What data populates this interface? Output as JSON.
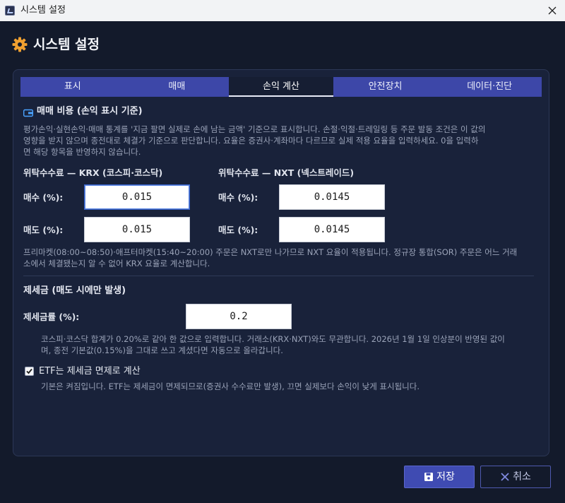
{
  "window": {
    "title": "시스템 설정"
  },
  "header": {
    "title": "시스템 설정"
  },
  "tabs": [
    {
      "label": "표시",
      "active": false
    },
    {
      "label": "매매",
      "active": false
    },
    {
      "label": "손익 계산",
      "active": true
    },
    {
      "label": "안전장치",
      "active": false
    },
    {
      "label": "데이터·진단",
      "active": false
    }
  ],
  "cost_section": {
    "title": "매매 비용 (손익 표시 기준)",
    "description_line1": "평가손익·실현손익·매매 통계를 '지금 팔면 실제로 손에 남는 금액' 기준으로 표시합니다. 손절·익절·트레일링 등 주문 발동 조건은 이 값의",
    "description_line2": "영향을 받지 않으며 종전대로 체결가 기준으로 판단합니다. 요율은 증권사·계좌마다 다르므로 실제 적용 요율을 입력하세요. 0을 입력하",
    "description_line3": "면 해당 항목을 반영하지 않습니다."
  },
  "krx": {
    "title": "위탁수수료 — KRX (코스피·코스닥)",
    "buy_label": "매수 (%):",
    "buy_value": "0.015",
    "sell_label": "매도 (%):",
    "sell_value": "0.015"
  },
  "nxt": {
    "title": "위탁수수료 — NXT (넥스트레이드)",
    "buy_label": "매수 (%):",
    "buy_value": "0.0145",
    "sell_label": "매도 (%):",
    "sell_value": "0.0145"
  },
  "market_note_line1": "프리마켓(08:00~08:50)·애프터마켓(15:40~20:00) 주문은 NXT로만 나가므로 NXT 요율이 적용됩니다. 정규장 통합(SOR) 주문은 어느 거래",
  "market_note_line2": "소에서 체결됐는지 알 수 없어 KRX 요율로 계산합니다.",
  "tax_section": {
    "title": "제세금 (매도 시에만 발생)",
    "rate_label": "제세금률 (%):",
    "rate_value": "0.2",
    "note_line1": "코스피·코스닥 합계가 0.20%로 같아 한 값으로 입력합니다. 거래소(KRX·NXT)와도 무관합니다. 2026년 1월 1일 인상분이 반영된 값이",
    "note_line2": "며, 종전 기본값(0.15%)을 그대로 쓰고 계셨다면 자동으로 올라갑니다."
  },
  "etf": {
    "checked": true,
    "label": "ETF는 제세금 면제로 계산",
    "note": "기본은 켜짐입니다. ETF는 제세금이 면제되므로(증권사 수수료만 발생), 끄면 실제보다 손익이 낮게 표시됩니다."
  },
  "buttons": {
    "save": "저장",
    "cancel": "취소"
  },
  "colors": {
    "accent": "#3f4bb2",
    "gear": "#f0a030",
    "background": "#131a2b",
    "panel": "#19223a"
  },
  "icons": {
    "app": "app-icon",
    "close": "close-icon",
    "gear": "gear-icon",
    "section": "wallet-icon",
    "save": "floppy-icon",
    "cancel": "x-icon",
    "checkbox": "checkmark-icon"
  }
}
